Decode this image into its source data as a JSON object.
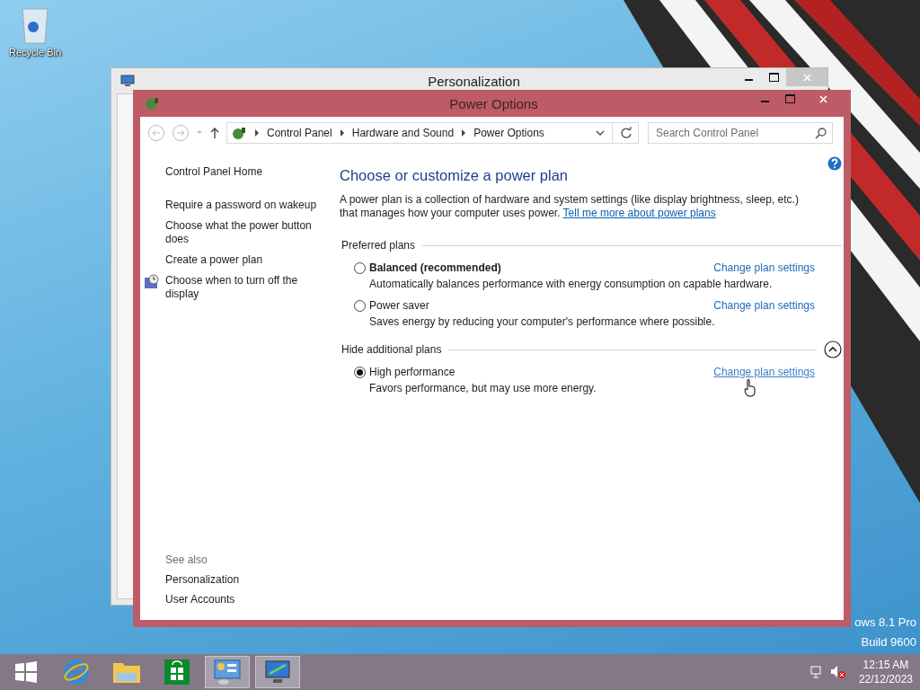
{
  "desktop": {
    "icons": [
      {
        "label": "Recycle Bin"
      }
    ],
    "watermark": [
      "ows 8.1 Pro",
      "Build 9600"
    ]
  },
  "back_window": {
    "title": "Personalization"
  },
  "window": {
    "title": "Power Options",
    "breadcrumbs": [
      "Control Panel",
      "Hardware and Sound",
      "Power Options"
    ],
    "search": {
      "placeholder": "Search Control Panel"
    }
  },
  "sidebar": {
    "links": [
      {
        "label": "Control Panel Home",
        "kind": "home"
      },
      {
        "label": "Require a password on wakeup",
        "kind": "plain"
      },
      {
        "label": "Choose what the power button does",
        "kind": "plain"
      },
      {
        "label": "Create a power plan",
        "kind": "plain"
      },
      {
        "label": "Choose when to turn off the display",
        "kind": "icon"
      }
    ],
    "see_also": {
      "heading": "See also",
      "links": [
        "Personalization",
        "User Accounts"
      ]
    }
  },
  "main": {
    "heading": "Choose or customize a power plan",
    "intro": "A power plan is a collection of hardware and system settings (like display brightness, sleep, etc.) that manages how your computer uses power.",
    "intro_link": "Tell me more about power plans",
    "groups": [
      {
        "label": "Preferred plans",
        "collapse_button": false,
        "plans": [
          {
            "name": "Balanced (recommended)",
            "recommended": true,
            "selected": false,
            "description": "Automatically balances performance with energy consumption on capable hardware.",
            "link": "Change plan settings",
            "hovered": false
          },
          {
            "name": "Power saver",
            "recommended": false,
            "selected": false,
            "description": "Saves energy by reducing your computer's performance where possible.",
            "link": "Change plan settings",
            "hovered": false
          }
        ]
      },
      {
        "label": "Hide additional plans",
        "collapse_button": true,
        "plans": [
          {
            "name": "High performance",
            "recommended": false,
            "selected": true,
            "description": "Favors performance, but may use more energy.",
            "link": "Change plan settings",
            "hovered": true
          }
        ]
      }
    ]
  },
  "taskbar": {
    "items": [
      {
        "kind": "start",
        "selected": false
      },
      {
        "kind": "browser",
        "selected": false
      },
      {
        "kind": "folder",
        "selected": false
      },
      {
        "kind": "store",
        "selected": false
      },
      {
        "kind": "control-panel",
        "selected": true
      },
      {
        "kind": "monitor",
        "selected": true
      }
    ],
    "clock": {
      "time": "12:15 AM",
      "date": "22/12/2023"
    }
  }
}
